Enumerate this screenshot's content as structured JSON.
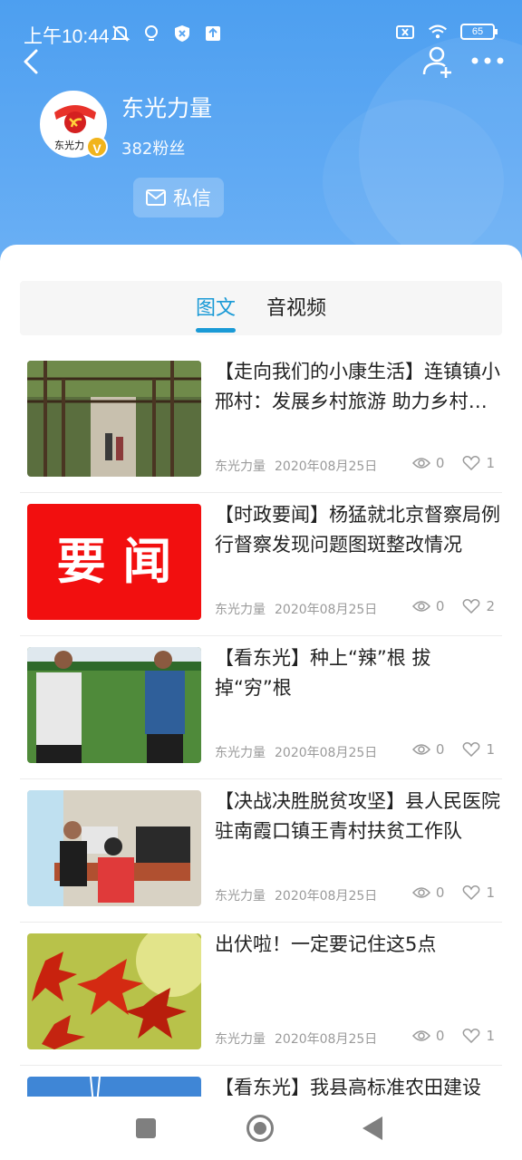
{
  "status_bar": {
    "time": "上午10:44",
    "battery": "65"
  },
  "profile": {
    "name": "东光力量",
    "fans": "382粉丝",
    "message_label": "私信",
    "verified_mark": "V",
    "avatar_text": "东光力"
  },
  "tabs": [
    {
      "label": "图文",
      "active": true
    },
    {
      "label": "音视频",
      "active": false
    }
  ],
  "articles": [
    {
      "title": "【走向我们的小康生活】连镇镇小邢村：发展乡村旅游 助力乡村振兴",
      "source": "东光力量",
      "date": "2020年08月25日",
      "views": "0",
      "likes": "1",
      "thumb": "trellis-icon"
    },
    {
      "title": "【时政要闻】杨猛就北京督察局例行督察发现问题图斑整改情况",
      "source": "东光力量",
      "date": "2020年08月25日",
      "views": "0",
      "likes": "2",
      "thumb": "yaowen-banner",
      "thumb_text": "要 闻"
    },
    {
      "title": "【看东光】种上“辣”根 拔掉“穷”根",
      "source": "东光力量",
      "date": "2020年08月25日",
      "views": "0",
      "likes": "1",
      "thumb": "field-icon"
    },
    {
      "title": "【决战决胜脱贫攻坚】县人民医院驻南霞口镇王青村扶贫工作队",
      "source": "东光力量",
      "date": "2020年08月25日",
      "views": "0",
      "likes": "1",
      "thumb": "office-icon"
    },
    {
      "title": "出伏啦！一定要记住这5点",
      "source": "东光力量",
      "date": "2020年08月25日",
      "views": "0",
      "likes": "1",
      "thumb": "maple-icon"
    },
    {
      "title": "【看东光】我县高标准农田建设",
      "source": "",
      "date": "",
      "views": "",
      "likes": "",
      "thumb": "sky-icon"
    }
  ],
  "colors": {
    "header": "#5aa6f2",
    "accent": "#1a9ad6",
    "banner_red": "#f20f0f"
  }
}
